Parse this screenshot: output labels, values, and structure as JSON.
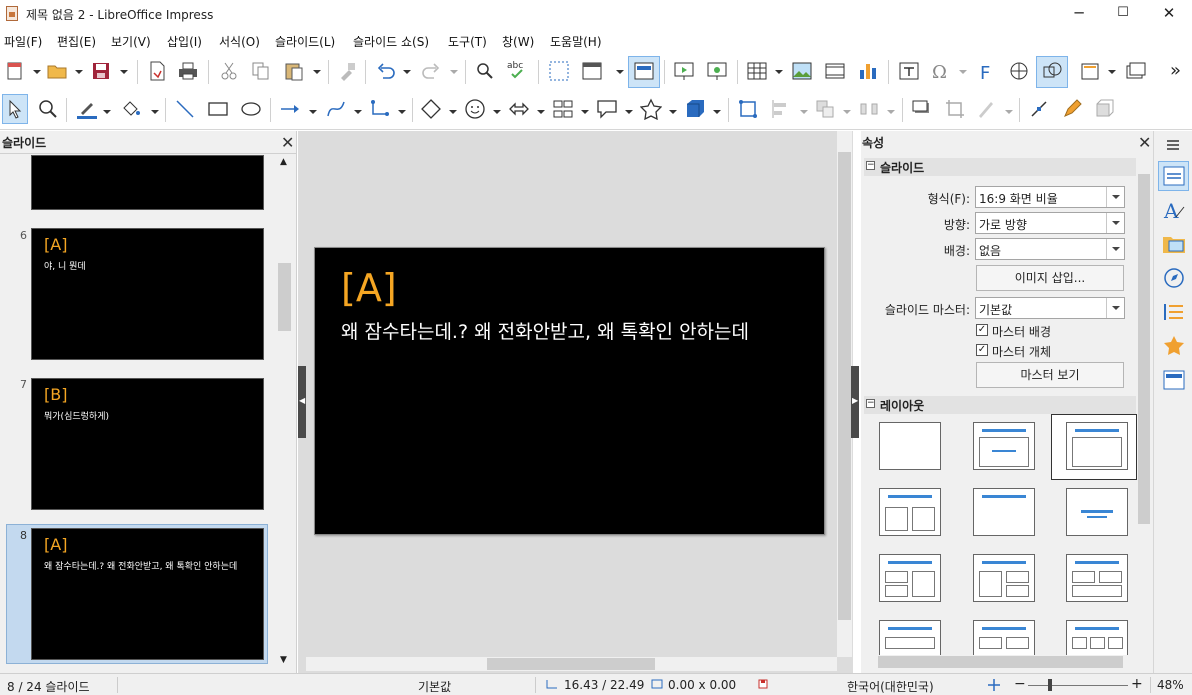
{
  "window": {
    "title": "제목 없음 2 - LibreOffice Impress",
    "min": "─",
    "max": "☐",
    "close": "✕"
  },
  "menu": [
    "파일(F)",
    "편집(E)",
    "보기(V)",
    "삽입(I)",
    "서식(O)",
    "슬라이드(L)",
    "슬라이드 쇼(S)",
    "도구(T)",
    "창(W)",
    "도움말(H)"
  ],
  "toolbar": {
    "overflow": "»",
    "icons": [
      "new-icon",
      "open-icon",
      "save-icon",
      "export-pdf-icon",
      "print-icon",
      "cut-icon",
      "copy-icon",
      "paste-icon",
      "clone-formatting-icon",
      "undo-icon",
      "redo-icon",
      "find-replace-icon",
      "spelling-icon",
      "grid-icon",
      "display-views-icon",
      "master-slide-icon",
      "start-first-slide-icon",
      "start-current-slide-icon",
      "table-icon",
      "image-icon",
      "media-icon",
      "chart-icon",
      "textbox-icon",
      "special-character-icon",
      "fontwork-icon",
      "hyperlink-icon",
      "show-draw-functions-icon",
      "header-footer-icon",
      "new-slide-icon"
    ]
  },
  "slides_pane": {
    "title": "슬라이드",
    "close": "✕",
    "slides": [
      {
        "num": "6",
        "title": "[A]",
        "body": "야, 니 뭔데"
      },
      {
        "num": "7",
        "title": "[B]",
        "body": "뭐가(심드렁하게)"
      },
      {
        "num": "8",
        "title": "[A]",
        "body": "왜 잠수타는데.? 왜 전화안받고, 왜 톡확인 안하는데"
      }
    ]
  },
  "main_slide": {
    "title": "[A]",
    "body": "왜 잠수타는데.? 왜 전화안받고, 왜 톡확인 안하는데"
  },
  "properties": {
    "title": "속성",
    "close": "✕",
    "slide_section": {
      "header": "슬라이드",
      "format_label": "형식(F):",
      "format_value": "16:9 화면 비율",
      "orientation_label": "방향:",
      "orientation_value": "가로 방향",
      "background_label": "배경:",
      "background_value": "없음",
      "insert_image": "이미지 삽입...",
      "master_label": "슬라이드 마스터:",
      "master_value": "기본값",
      "master_background": "마스터 배경",
      "master_objects": "마스터 개체",
      "master_view": "마스터 보기"
    },
    "layout_section": {
      "header": "레이아웃"
    }
  },
  "status": {
    "slide_count": "8 / 24 슬라이드",
    "master": "기본값",
    "position": "16.43 / 22.49",
    "size": "0.00 x 0.00",
    "language": "한국어(대한민국)",
    "zoom": "48%",
    "zoom_plus": "+",
    "zoom_minus": "−"
  },
  "colors": {
    "accent": "#f5a623",
    "selection": "#c3d9ef",
    "layout_bar": "#3a86d4"
  }
}
